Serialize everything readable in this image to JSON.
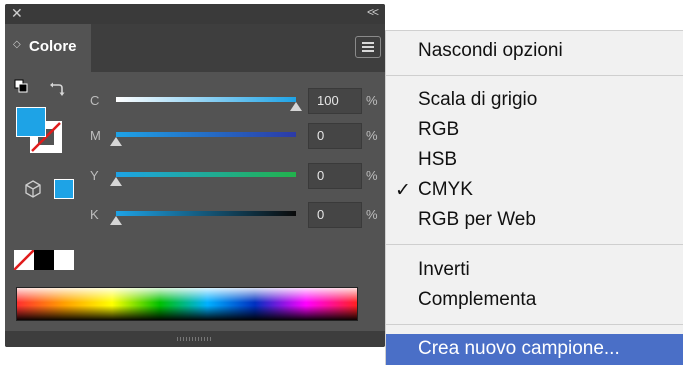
{
  "titlebar": {
    "close_glyph": "✕",
    "collapse_glyph": "<<"
  },
  "tab": {
    "label": "Colore",
    "arrows_glyph": "◇"
  },
  "channels": [
    {
      "letter": "C",
      "value": "100",
      "unit": "%",
      "level": 1.0,
      "gradient": [
        "#ffffff",
        "#1ea3e6"
      ]
    },
    {
      "letter": "M",
      "value": "0",
      "unit": "%",
      "level": 0.0,
      "gradient": [
        "#1ea3e6",
        "#2c3aa6"
      ]
    },
    {
      "letter": "Y",
      "value": "0",
      "unit": "%",
      "level": 0.0,
      "gradient": [
        "#1ea3e6",
        "#22b24c"
      ]
    },
    {
      "letter": "K",
      "value": "0",
      "unit": "%",
      "level": 0.0,
      "gradient": [
        "#1ea3e6",
        "#0a0a0a"
      ]
    }
  ],
  "fill_color": "#1ea3e6",
  "menu": {
    "hide_options": "Nascondi opzioni",
    "grayscale": "Scala di grigio",
    "rgb": "RGB",
    "hsb": "HSB",
    "cmyk": "CMYK",
    "web_rgb": "RGB per Web",
    "invert": "Inverti",
    "complement": "Complementa",
    "new_swatch": "Crea nuovo campione...",
    "checked_glyph": "✓"
  },
  "colors": {
    "panel_bg": "#535353",
    "menu_bg": "#f1f1f1",
    "highlight": "#4a6fc7"
  }
}
